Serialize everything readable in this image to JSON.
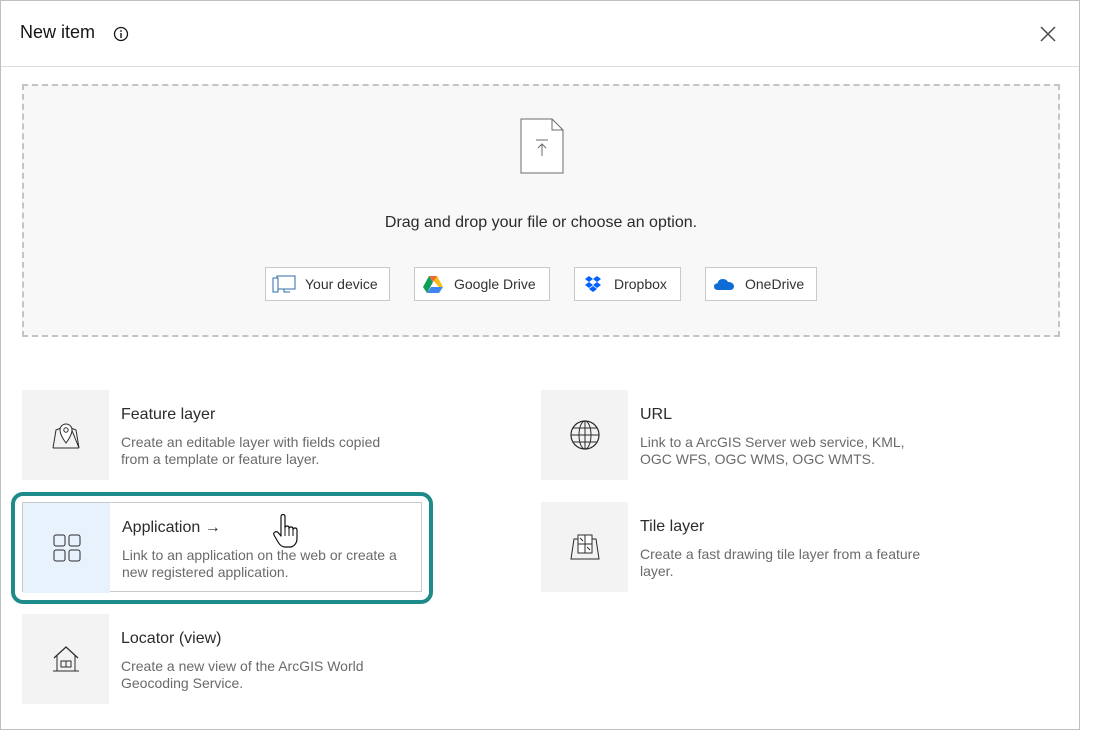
{
  "dialog": {
    "title": "New item",
    "dropzone": {
      "text": "Drag and drop your file or choose an option.",
      "sources": [
        {
          "label": "Your device",
          "icon": "device-icon"
        },
        {
          "label": "Google Drive",
          "icon": "google-drive-icon"
        },
        {
          "label": "Dropbox",
          "icon": "dropbox-icon"
        },
        {
          "label": "OneDrive",
          "icon": "onedrive-icon"
        }
      ]
    },
    "items": [
      {
        "title": "Feature layer",
        "description": "Create an editable layer with fields copied from a template or feature layer.",
        "icon": "map-pin-icon"
      },
      {
        "title": "URL",
        "description": "Link to a ArcGIS Server web service, KML, OGC WFS, OGC WMS, OGC WMTS.",
        "icon": "globe-icon"
      },
      {
        "title": "Application →",
        "description": "Link to an application on the web or create a new registered application.",
        "icon": "grid-icon",
        "selected": true
      },
      {
        "title": "Tile layer",
        "description": "Create a fast drawing tile layer from a feature layer.",
        "icon": "tile-map-icon"
      },
      {
        "title": "Locator (view)",
        "description": "Create a new view of the ArcGIS World Geocoding Service.",
        "icon": "house-icon"
      }
    ]
  },
  "colors": {
    "highlight": "#1f8a8a",
    "selected_thumb": "#e8f2fd"
  }
}
